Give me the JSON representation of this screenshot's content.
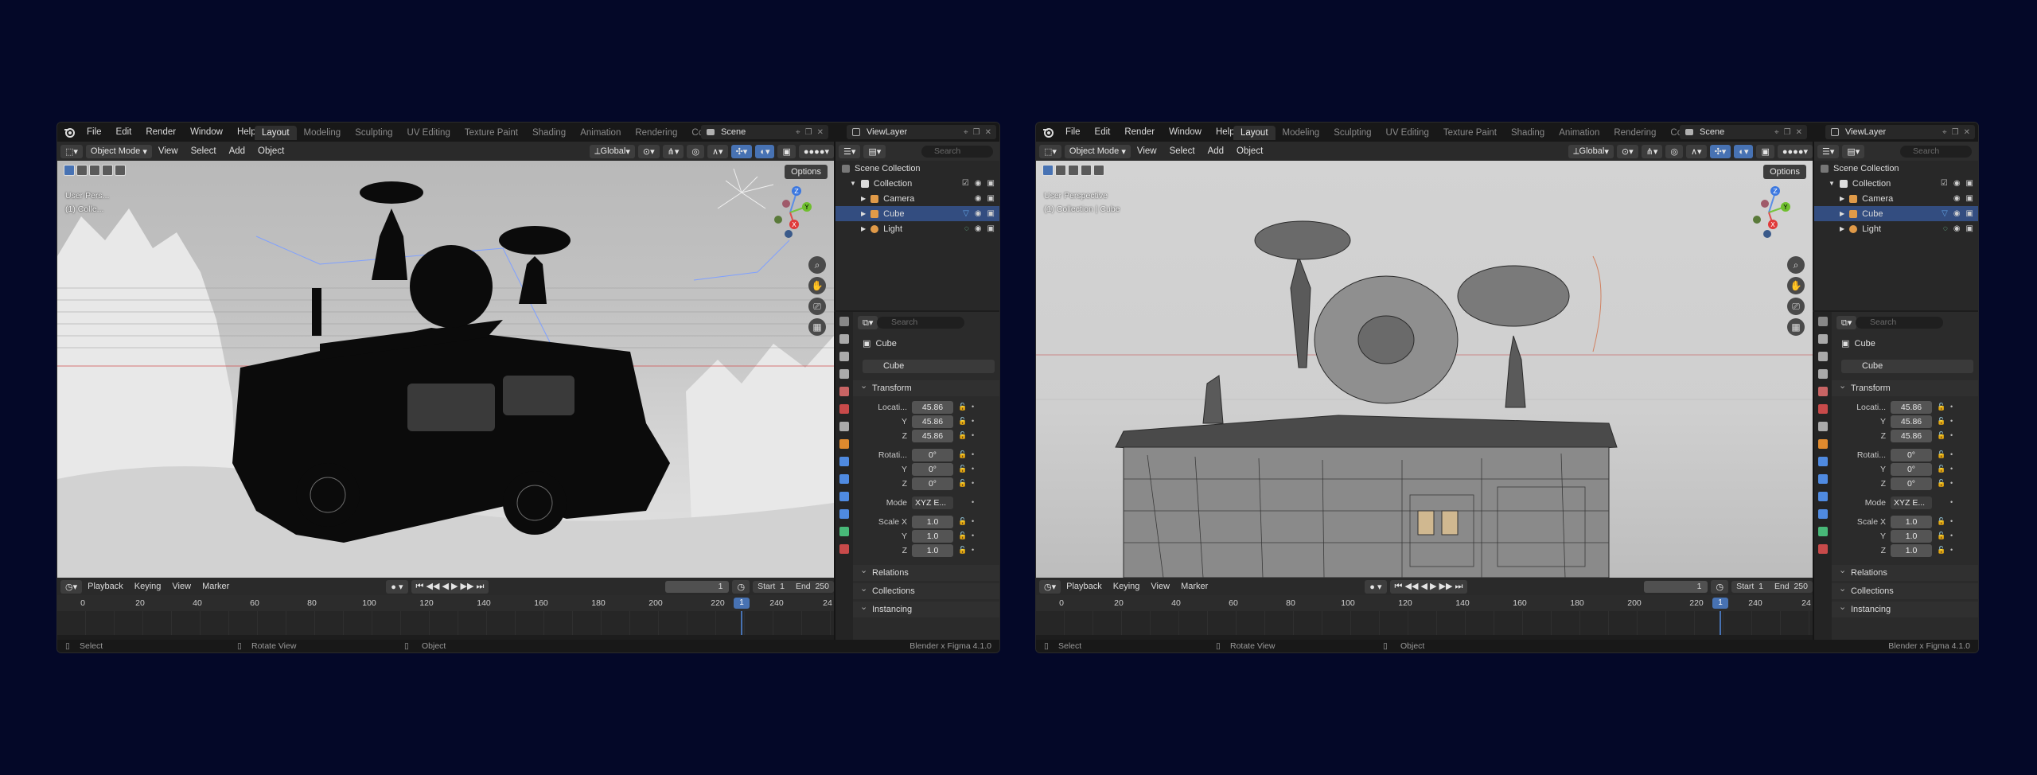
{
  "menu": [
    "File",
    "Edit",
    "Render",
    "Window",
    "Help"
  ],
  "workspaces": [
    "Layout",
    "Modeling",
    "Sculpting",
    "UV Editing",
    "Texture Paint",
    "Shading",
    "Animation",
    "Rendering",
    "Comp"
  ],
  "scene": "Scene",
  "view_layer": "ViewLayer",
  "header": {
    "mode": "Object Mode",
    "menus": [
      "View",
      "Select",
      "Add",
      "Object"
    ],
    "orientation": "Global",
    "options": "Options"
  },
  "viewport_info": {
    "w1_line1": "User Pers...",
    "w1_line2": "(1) Colle...",
    "w2_line1": "User Perspective",
    "w2_line2": "(1) Collection | Cube"
  },
  "outliner": {
    "search_placeholder": "Search",
    "items": [
      "Scene Collection",
      "Collection",
      "Camera",
      "Cube",
      "Light"
    ]
  },
  "properties": {
    "search_placeholder": "Search",
    "object_name": "Cube",
    "data_name": "Cube",
    "transform": "Transform",
    "location_label": "Locati...",
    "rotation_label": "Rotati...",
    "mode_label": "Mode",
    "scale_label": "Scale X",
    "y": "Y",
    "z": "Z",
    "location": [
      "45.86",
      "45.86",
      "45.86"
    ],
    "rotation": [
      "0°",
      "0°",
      "0°"
    ],
    "mode": "XYZ E...",
    "scale": [
      "1.0",
      "1.0",
      "1.0"
    ],
    "panels": [
      "Relations",
      "Collections",
      "Instancing"
    ]
  },
  "timeline": {
    "menus": [
      "Playback",
      "Keying",
      "View",
      "Marker"
    ],
    "current_frame": "1",
    "start_label": "Start",
    "start": "1",
    "end_label": "End",
    "end": "250",
    "ticks": [
      "0",
      "20",
      "40",
      "60",
      "80",
      "100",
      "120",
      "140",
      "160",
      "180",
      "200",
      "220",
      "240",
      "24"
    ],
    "cursor": "1"
  },
  "status": {
    "select": "Select",
    "rotate": "Rotate View",
    "object": "Object",
    "version": "Blender x Figma 4.1.0"
  },
  "colors": {
    "accent": "#4772b3",
    "background": "#040828",
    "selected_row": "#334d80"
  }
}
